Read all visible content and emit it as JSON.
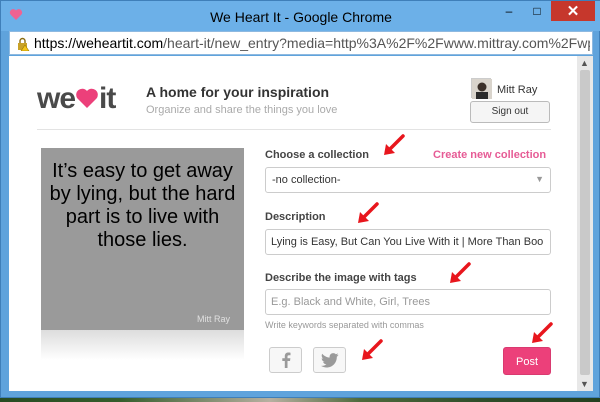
{
  "window": {
    "title": "We Heart It - Google Chrome"
  },
  "browser": {
    "url_host": "https://weheartit.com",
    "url_path": "/heart-it/new_entry?media=http%3A%2F%2Fwww.mittray.com%2Fwp-co"
  },
  "header": {
    "logo_prefix": "we",
    "logo_suffix": "it",
    "tagline": "A home for your inspiration",
    "subtagline": "Organize and share the things you love",
    "user_name": "Mitt Ray",
    "signout_label": "Sign out"
  },
  "image": {
    "quote": "It’s easy to get away by lying, but the hard part is to live with those lies.",
    "watermark": "Mitt Ray"
  },
  "form": {
    "collection_label": "Choose a collection",
    "create_collection_label": "Create new collection",
    "collection_value": "-no collection-",
    "description_label": "Description",
    "description_value": "Lying is Easy, But Can You Live With it | More Than Boo",
    "tags_label": "Describe the image with tags",
    "tags_placeholder": "E.g. Black and White, Girl, Trees",
    "tags_hint": "Write keywords separated with commas",
    "post_label": "Post"
  },
  "colors": {
    "brand_pink": "#ec407a",
    "link_pink": "#e65b95",
    "arrow_red": "#e8161d",
    "chrome_blue": "#6cb0e8"
  },
  "icons": {
    "facebook": "facebook-icon",
    "twitter": "twitter-icon",
    "annotation": "red-arrow-icon"
  }
}
